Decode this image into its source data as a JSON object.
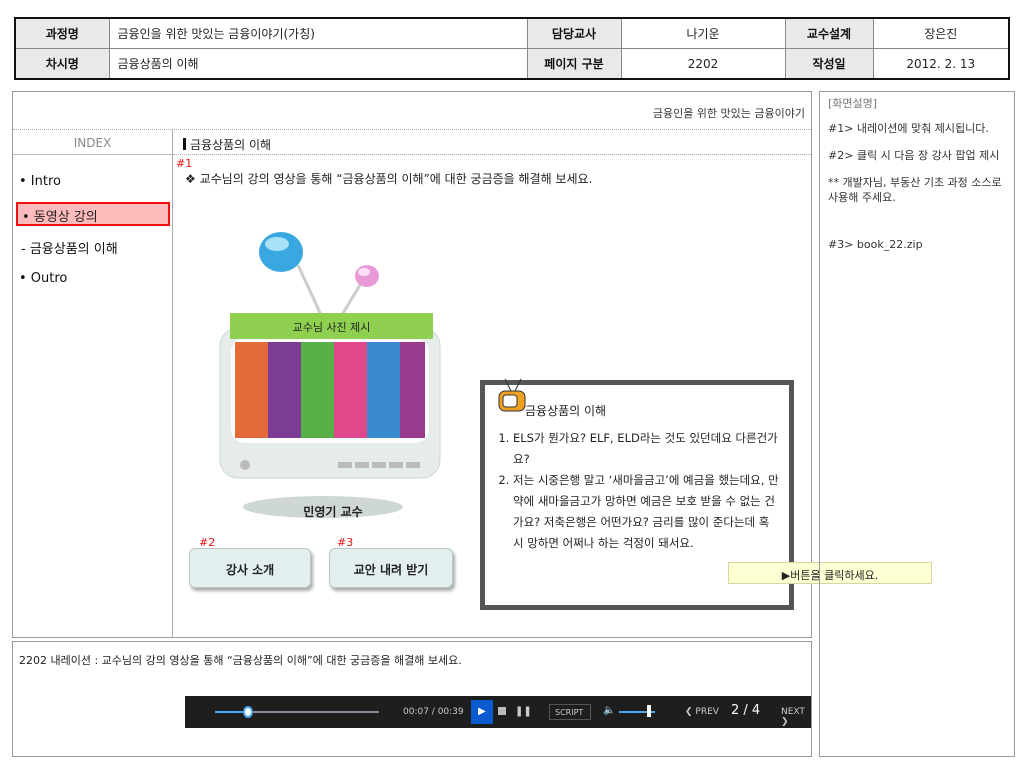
{
  "header": {
    "course_label": "과정명",
    "course_value": "금융인을 위한 맛있는 금융이야기(가칭)",
    "teacher_label": "담당교사",
    "teacher_value": "나기운",
    "design_label": "교수설계",
    "design_value": "장은진",
    "session_label": "차시명",
    "session_value": "금융상품의 이해",
    "page_label": "페이지 구분",
    "page_value": "2202",
    "date_label": "작성일",
    "date_value": "2012. 2. 13"
  },
  "topline": "금융인을 위한 맛있는 금융이야기",
  "index": {
    "title": "INDEX",
    "items": [
      "• Intro",
      "• 동영상 강의",
      "- 금융상품의 이해",
      "• Outro"
    ]
  },
  "content": {
    "title": "금융상품의 이해",
    "marker1": "#1",
    "instruction": "❖ 교수님의 강의 영상을 통해 “금융상품의 이해”에 대한 궁금증을 해결해 보세요.",
    "tv_label": "교수님 사진 제시",
    "professor": "민영기 교수",
    "bubble_title": "금융상품의 이해",
    "questions": [
      "ELS가 뭔가요? ELF, ELD라는 것도 있던데요 다른건가요?",
      "저는 시중은행 말고 ‘새마을금고’에 예금을 했는데요, 만약에 새마을금고가 망하면 예금은 보호 받을 수 없는 건가요?  저축은행은 어떤가요?  금리를 많이 준다는데 혹시 망하면 어쩌나 하는 걱정이 돼서요."
    ],
    "marker2": "#2",
    "marker3": "#3",
    "btn_intro": "강사 소개",
    "btn_download": "교안 내려 받기",
    "tooltip": "▶버튼을 클릭하세요."
  },
  "player": {
    "time": "00:07 / 00:39",
    "script": "SCRIPT",
    "prev": "PREV",
    "page": "2 / 4",
    "next": "NEXT",
    "progress": 0.2
  },
  "narration": "2202 내레이션 : 교수님의 강의 영상을 통해 “금융상품의 이해”에 대한 궁금증을 해결해 보세요.",
  "notes": {
    "label": "[화면설명]",
    "items": [
      "#1> 내레이션에 맞춰 제시됩니다.",
      "#2> 클릭 시 다음 장 강사 팝업 제시",
      "** 개발자님, 부동산 기초 과정 소스로 사용해 주세요.",
      "#3> book_22.zip"
    ]
  },
  "colors": {
    "accent_red": "#e11111",
    "nav_active_bg": "#fbb",
    "tv_green": "#7ccf50"
  }
}
